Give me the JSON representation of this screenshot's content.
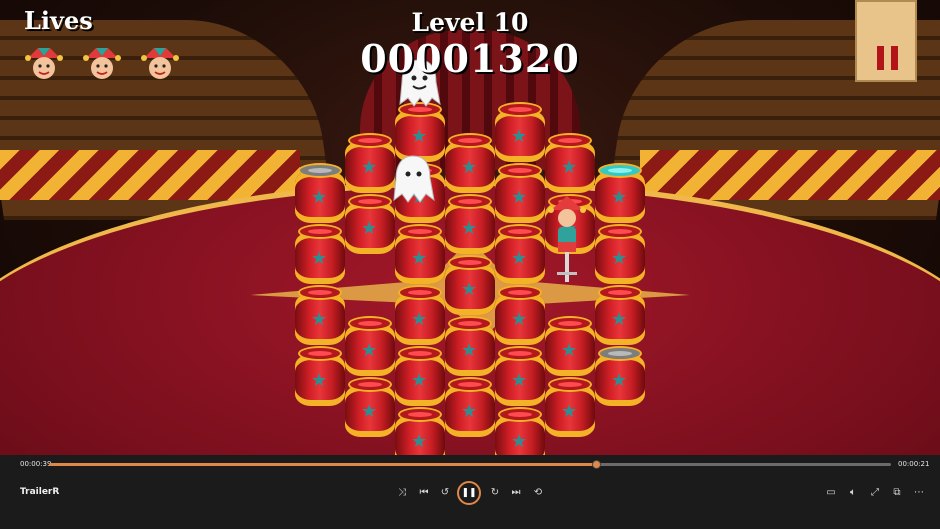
{
  "hud": {
    "lives_label": "Lives",
    "lives_icon": "jester-head-icon",
    "level_label": "Level 10",
    "score": "00001320",
    "pause_icon": "pause-icon"
  },
  "player": {
    "elapsed": "00:00:39",
    "remaining": "00:00:21",
    "title": "TrailerR",
    "progress": 0.65,
    "colors": {
      "accent": "#e0884a",
      "bar_bg": "#1b1b1b"
    },
    "controls": [
      "shuffle-icon",
      "previous-icon",
      "rewind-icon",
      "play-pause-icon",
      "forward-icon",
      "next-icon",
      "repeat-icon"
    ],
    "right_controls": [
      "mini-view-icon",
      "volume-icon",
      "fullscreen-icon",
      "cast-icon",
      "more-icon"
    ]
  },
  "game": {
    "colors": {
      "barrel": "#d32027",
      "band": "#f4b226",
      "star": "#2e8f93"
    },
    "barrels": [
      {
        "col": 2,
        "row": 0,
        "state": "red"
      },
      {
        "col": 4,
        "row": 0,
        "state": "red"
      },
      {
        "col": 1,
        "row": 1,
        "state": "red"
      },
      {
        "col": 3,
        "row": 1,
        "state": "red"
      },
      {
        "col": 5,
        "row": 1,
        "state": "red"
      },
      {
        "col": 0,
        "row": 2,
        "state": "empty"
      },
      {
        "col": 2,
        "row": 2,
        "state": "red"
      },
      {
        "col": 4,
        "row": 2,
        "state": "red"
      },
      {
        "col": 6,
        "row": 2,
        "state": "teal"
      },
      {
        "col": 1,
        "row": 3,
        "state": "red"
      },
      {
        "col": 3,
        "row": 3,
        "state": "red"
      },
      {
        "col": 5,
        "row": 3,
        "state": "red"
      },
      {
        "col": 0,
        "row": 4,
        "state": "red"
      },
      {
        "col": 2,
        "row": 4,
        "state": "red"
      },
      {
        "col": 4,
        "row": 4,
        "state": "red"
      },
      {
        "col": 6,
        "row": 4,
        "state": "red"
      },
      {
        "col": 3,
        "row": 5,
        "state": "red"
      },
      {
        "col": 0,
        "row": 6,
        "state": "red"
      },
      {
        "col": 2,
        "row": 6,
        "state": "red"
      },
      {
        "col": 4,
        "row": 6,
        "state": "red"
      },
      {
        "col": 6,
        "row": 6,
        "state": "red"
      },
      {
        "col": 1,
        "row": 7,
        "state": "red"
      },
      {
        "col": 3,
        "row": 7,
        "state": "red"
      },
      {
        "col": 5,
        "row": 7,
        "state": "red"
      },
      {
        "col": 0,
        "row": 8,
        "state": "red"
      },
      {
        "col": 2,
        "row": 8,
        "state": "red"
      },
      {
        "col": 4,
        "row": 8,
        "state": "red"
      },
      {
        "col": 6,
        "row": 8,
        "state": "empty"
      },
      {
        "col": 1,
        "row": 9,
        "state": "red"
      },
      {
        "col": 3,
        "row": 9,
        "state": "red"
      },
      {
        "col": 5,
        "row": 9,
        "state": "red"
      },
      {
        "col": 2,
        "row": 10,
        "state": "red"
      },
      {
        "col": 4,
        "row": 10,
        "state": "red"
      }
    ],
    "ghost_count": 2
  }
}
